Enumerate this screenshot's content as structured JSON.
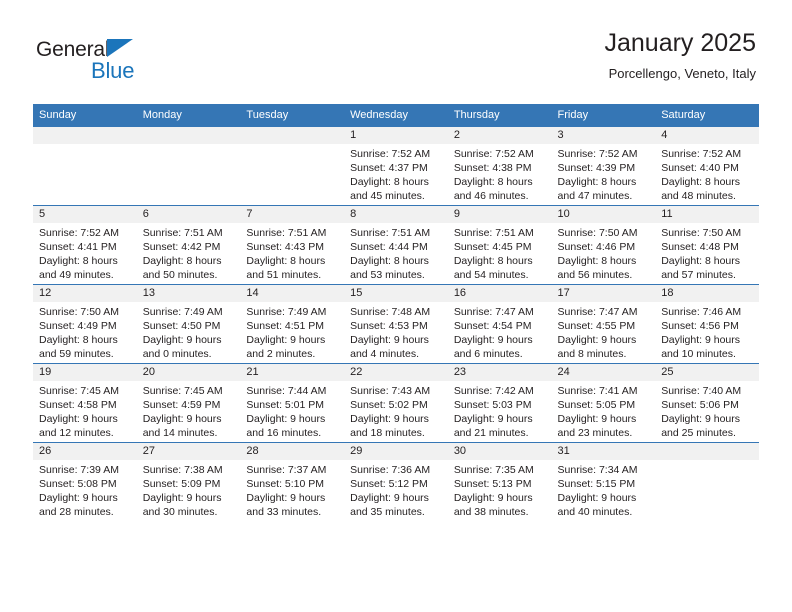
{
  "brand": {
    "name_top": "General",
    "name_bottom": "Blue",
    "triangle_color": "#1b75bb"
  },
  "header": {
    "title": "January 2025",
    "subtitle": "Porcellengo, Veneto, Italy"
  },
  "theme": {
    "header_bg": "#3576b5",
    "daynum_bg": "#f1f1f1",
    "text": "#231f20",
    "page_bg": "#ffffff"
  },
  "calendar": {
    "weekday_headers": [
      "Sunday",
      "Monday",
      "Tuesday",
      "Wednesday",
      "Thursday",
      "Friday",
      "Saturday"
    ],
    "weeks": [
      [
        {
          "day": "",
          "sunrise": "",
          "sunset": "",
          "daylight_1": "",
          "daylight_2": ""
        },
        {
          "day": "",
          "sunrise": "",
          "sunset": "",
          "daylight_1": "",
          "daylight_2": ""
        },
        {
          "day": "",
          "sunrise": "",
          "sunset": "",
          "daylight_1": "",
          "daylight_2": ""
        },
        {
          "day": "1",
          "sunrise": "Sunrise: 7:52 AM",
          "sunset": "Sunset: 4:37 PM",
          "daylight_1": "Daylight: 8 hours",
          "daylight_2": "and 45 minutes."
        },
        {
          "day": "2",
          "sunrise": "Sunrise: 7:52 AM",
          "sunset": "Sunset: 4:38 PM",
          "daylight_1": "Daylight: 8 hours",
          "daylight_2": "and 46 minutes."
        },
        {
          "day": "3",
          "sunrise": "Sunrise: 7:52 AM",
          "sunset": "Sunset: 4:39 PM",
          "daylight_1": "Daylight: 8 hours",
          "daylight_2": "and 47 minutes."
        },
        {
          "day": "4",
          "sunrise": "Sunrise: 7:52 AM",
          "sunset": "Sunset: 4:40 PM",
          "daylight_1": "Daylight: 8 hours",
          "daylight_2": "and 48 minutes."
        }
      ],
      [
        {
          "day": "5",
          "sunrise": "Sunrise: 7:52 AM",
          "sunset": "Sunset: 4:41 PM",
          "daylight_1": "Daylight: 8 hours",
          "daylight_2": "and 49 minutes."
        },
        {
          "day": "6",
          "sunrise": "Sunrise: 7:51 AM",
          "sunset": "Sunset: 4:42 PM",
          "daylight_1": "Daylight: 8 hours",
          "daylight_2": "and 50 minutes."
        },
        {
          "day": "7",
          "sunrise": "Sunrise: 7:51 AM",
          "sunset": "Sunset: 4:43 PM",
          "daylight_1": "Daylight: 8 hours",
          "daylight_2": "and 51 minutes."
        },
        {
          "day": "8",
          "sunrise": "Sunrise: 7:51 AM",
          "sunset": "Sunset: 4:44 PM",
          "daylight_1": "Daylight: 8 hours",
          "daylight_2": "and 53 minutes."
        },
        {
          "day": "9",
          "sunrise": "Sunrise: 7:51 AM",
          "sunset": "Sunset: 4:45 PM",
          "daylight_1": "Daylight: 8 hours",
          "daylight_2": "and 54 minutes."
        },
        {
          "day": "10",
          "sunrise": "Sunrise: 7:50 AM",
          "sunset": "Sunset: 4:46 PM",
          "daylight_1": "Daylight: 8 hours",
          "daylight_2": "and 56 minutes."
        },
        {
          "day": "11",
          "sunrise": "Sunrise: 7:50 AM",
          "sunset": "Sunset: 4:48 PM",
          "daylight_1": "Daylight: 8 hours",
          "daylight_2": "and 57 minutes."
        }
      ],
      [
        {
          "day": "12",
          "sunrise": "Sunrise: 7:50 AM",
          "sunset": "Sunset: 4:49 PM",
          "daylight_1": "Daylight: 8 hours",
          "daylight_2": "and 59 minutes."
        },
        {
          "day": "13",
          "sunrise": "Sunrise: 7:49 AM",
          "sunset": "Sunset: 4:50 PM",
          "daylight_1": "Daylight: 9 hours",
          "daylight_2": "and 0 minutes."
        },
        {
          "day": "14",
          "sunrise": "Sunrise: 7:49 AM",
          "sunset": "Sunset: 4:51 PM",
          "daylight_1": "Daylight: 9 hours",
          "daylight_2": "and 2 minutes."
        },
        {
          "day": "15",
          "sunrise": "Sunrise: 7:48 AM",
          "sunset": "Sunset: 4:53 PM",
          "daylight_1": "Daylight: 9 hours",
          "daylight_2": "and 4 minutes."
        },
        {
          "day": "16",
          "sunrise": "Sunrise: 7:47 AM",
          "sunset": "Sunset: 4:54 PM",
          "daylight_1": "Daylight: 9 hours",
          "daylight_2": "and 6 minutes."
        },
        {
          "day": "17",
          "sunrise": "Sunrise: 7:47 AM",
          "sunset": "Sunset: 4:55 PM",
          "daylight_1": "Daylight: 9 hours",
          "daylight_2": "and 8 minutes."
        },
        {
          "day": "18",
          "sunrise": "Sunrise: 7:46 AM",
          "sunset": "Sunset: 4:56 PM",
          "daylight_1": "Daylight: 9 hours",
          "daylight_2": "and 10 minutes."
        }
      ],
      [
        {
          "day": "19",
          "sunrise": "Sunrise: 7:45 AM",
          "sunset": "Sunset: 4:58 PM",
          "daylight_1": "Daylight: 9 hours",
          "daylight_2": "and 12 minutes."
        },
        {
          "day": "20",
          "sunrise": "Sunrise: 7:45 AM",
          "sunset": "Sunset: 4:59 PM",
          "daylight_1": "Daylight: 9 hours",
          "daylight_2": "and 14 minutes."
        },
        {
          "day": "21",
          "sunrise": "Sunrise: 7:44 AM",
          "sunset": "Sunset: 5:01 PM",
          "daylight_1": "Daylight: 9 hours",
          "daylight_2": "and 16 minutes."
        },
        {
          "day": "22",
          "sunrise": "Sunrise: 7:43 AM",
          "sunset": "Sunset: 5:02 PM",
          "daylight_1": "Daylight: 9 hours",
          "daylight_2": "and 18 minutes."
        },
        {
          "day": "23",
          "sunrise": "Sunrise: 7:42 AM",
          "sunset": "Sunset: 5:03 PM",
          "daylight_1": "Daylight: 9 hours",
          "daylight_2": "and 21 minutes."
        },
        {
          "day": "24",
          "sunrise": "Sunrise: 7:41 AM",
          "sunset": "Sunset: 5:05 PM",
          "daylight_1": "Daylight: 9 hours",
          "daylight_2": "and 23 minutes."
        },
        {
          "day": "25",
          "sunrise": "Sunrise: 7:40 AM",
          "sunset": "Sunset: 5:06 PM",
          "daylight_1": "Daylight: 9 hours",
          "daylight_2": "and 25 minutes."
        }
      ],
      [
        {
          "day": "26",
          "sunrise": "Sunrise: 7:39 AM",
          "sunset": "Sunset: 5:08 PM",
          "daylight_1": "Daylight: 9 hours",
          "daylight_2": "and 28 minutes."
        },
        {
          "day": "27",
          "sunrise": "Sunrise: 7:38 AM",
          "sunset": "Sunset: 5:09 PM",
          "daylight_1": "Daylight: 9 hours",
          "daylight_2": "and 30 minutes."
        },
        {
          "day": "28",
          "sunrise": "Sunrise: 7:37 AM",
          "sunset": "Sunset: 5:10 PM",
          "daylight_1": "Daylight: 9 hours",
          "daylight_2": "and 33 minutes."
        },
        {
          "day": "29",
          "sunrise": "Sunrise: 7:36 AM",
          "sunset": "Sunset: 5:12 PM",
          "daylight_1": "Daylight: 9 hours",
          "daylight_2": "and 35 minutes."
        },
        {
          "day": "30",
          "sunrise": "Sunrise: 7:35 AM",
          "sunset": "Sunset: 5:13 PM",
          "daylight_1": "Daylight: 9 hours",
          "daylight_2": "and 38 minutes."
        },
        {
          "day": "31",
          "sunrise": "Sunrise: 7:34 AM",
          "sunset": "Sunset: 5:15 PM",
          "daylight_1": "Daylight: 9 hours",
          "daylight_2": "and 40 minutes."
        },
        {
          "day": "",
          "sunrise": "",
          "sunset": "",
          "daylight_1": "",
          "daylight_2": ""
        }
      ]
    ]
  }
}
